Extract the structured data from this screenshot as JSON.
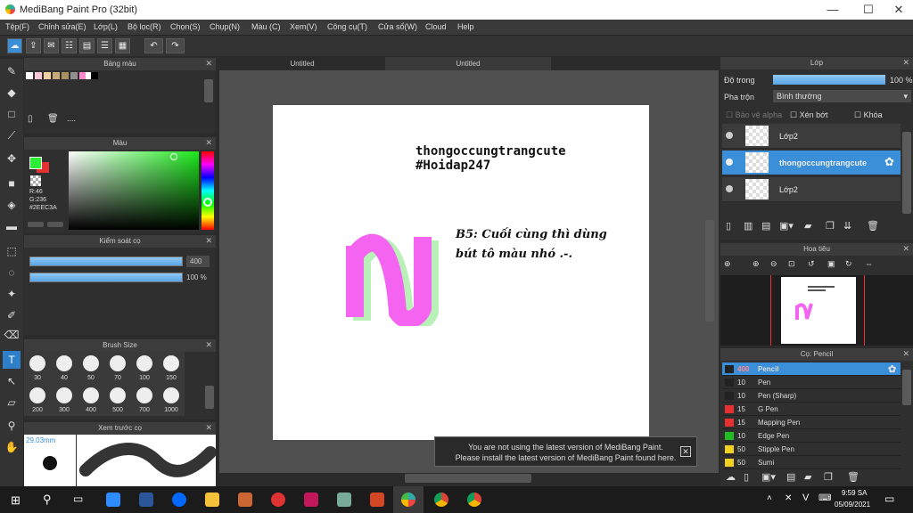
{
  "window": {
    "title": "MediBang Paint Pro (32bit)",
    "minimize": "—",
    "maximize": "☐",
    "close": "✕"
  },
  "menu": [
    "Tệp(F)",
    "Chỉnh sửa(E)",
    "Lớp(L)",
    "Bộ lọc(R)",
    "Chọn(S)",
    "Chụp(N)",
    "Màu (C)",
    "Xem(V)",
    "Công cụ(T)",
    "Cửa sổ(W)",
    "Cloud",
    "Help"
  ],
  "panels": {
    "palette": {
      "title": "Bảng màu",
      "more": "....",
      "colors": [
        "#ffffff",
        "#f8c8d8",
        "#f0d0a0",
        "#c8a878",
        "#a89060",
        "#909090",
        "#ff88cc",
        "#ffffff",
        "#000000"
      ]
    },
    "color": {
      "title": "Màu",
      "r": "R:46",
      "g": "G:236",
      "hex": "#2EEC3A",
      "primary": "#2EEC3A",
      "secondary": "#e83030"
    },
    "brushcontrol": {
      "title": "Kiểm soát cọ",
      "size": "400",
      "opacity": "100 %"
    },
    "brushsize": {
      "title": "Brush Size",
      "sizes": [
        "30",
        "40",
        "50",
        "70",
        "100",
        "150",
        "200",
        "300",
        "400",
        "500",
        "700",
        "1000"
      ]
    },
    "preview": {
      "title": "Xem trước cọ",
      "size": "29.03mm"
    }
  },
  "tabs": [
    "Untitled",
    "Untitled"
  ],
  "canvas": {
    "line1": "thongoccungtrangcute",
    "line2": "#Hoidap247",
    "note1": "B5: Cuối cùng thì dùng",
    "note2": "bút tô màu nhó .-.",
    "pink": "#f564f0",
    "green": "#b8f0b8"
  },
  "notice": {
    "line1": "You are not using the latest version of MediBang Paint.",
    "line2": "Please install the latest version of MediBang Paint found here.",
    "close": "✕"
  },
  "layer": {
    "title": "Lớp",
    "opacity_label": "Độ trong",
    "opacity": "100 %",
    "opacity_fraction": 1.0,
    "blend_label": "Pha trộn",
    "blend": "Bình thường",
    "alpha_protect": "Bảo vệ alpha",
    "clipping": "Xén bớt",
    "lock": "Khóa",
    "items": [
      {
        "name": "Lớp2",
        "selected": false
      },
      {
        "name": "thongoccungtrangcute",
        "selected": true
      },
      {
        "name": "Lớp2",
        "selected": false
      }
    ]
  },
  "navigator": {
    "title": "Hoa tiêu"
  },
  "brushes": {
    "title": "Cọ: Pencil",
    "items": [
      {
        "size": "400",
        "name": "Pencil",
        "color": "#222222",
        "selected": true
      },
      {
        "size": "10",
        "name": "Pen",
        "color": "#222222"
      },
      {
        "size": "10",
        "name": "Pen (Sharp)",
        "color": "#222222"
      },
      {
        "size": "15",
        "name": "G Pen",
        "color": "#e83030"
      },
      {
        "size": "15",
        "name": "Mapping Pen",
        "color": "#e83030"
      },
      {
        "size": "10",
        "name": "Edge Pen",
        "color": "#22bb22"
      },
      {
        "size": "50",
        "name": "Stipple Pen",
        "color": "#f0d020"
      },
      {
        "size": "50",
        "name": "Sumi",
        "color": "#f0d020"
      }
    ]
  },
  "taskbar": {
    "time": "9:59 SA",
    "date": "05/09/2021",
    "lang": "V"
  }
}
